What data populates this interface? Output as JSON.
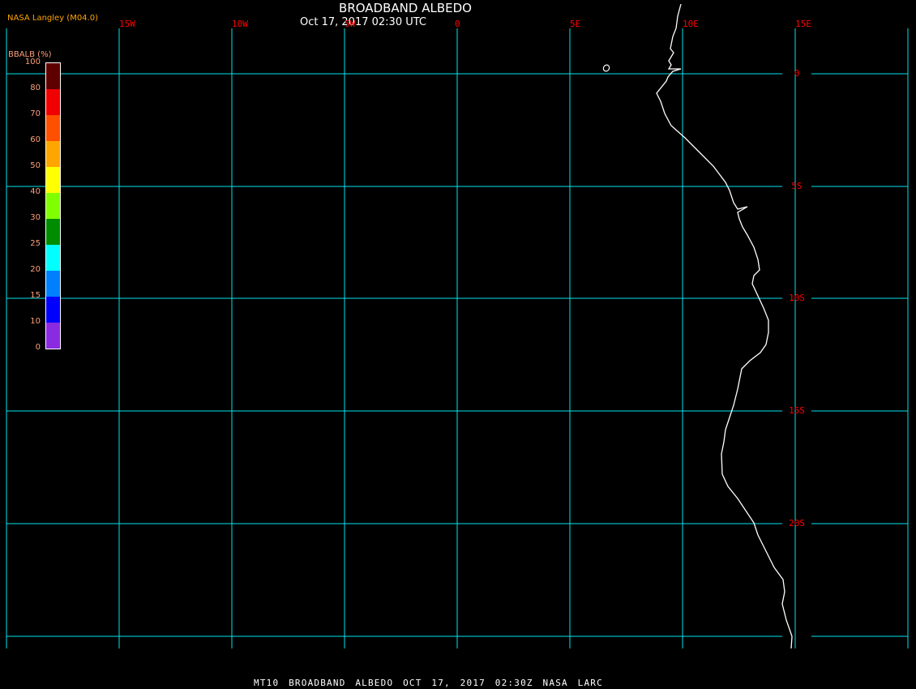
{
  "header": {
    "title": "BROADBAND ALBEDO",
    "subtitle": "Oct 17, 2017 02:30 UTC",
    "organization": "NASA Langley (M04.0)"
  },
  "map": {
    "grid_color": "#00e5ee",
    "coastline_color": "#ffffff",
    "label_color": "#ff0000",
    "longitude_labels": [
      "15W",
      "10W",
      "5W",
      "0",
      "5E",
      "10E",
      "15E"
    ],
    "latitude_labels": [
      "0",
      "5S",
      "10S",
      "15S",
      "20S"
    ]
  },
  "legend": {
    "title": "BBALB (%)",
    "ticks": [
      "100",
      "80",
      "70",
      "60",
      "50",
      "40",
      "30",
      "25",
      "20",
      "15",
      "10",
      "0"
    ],
    "colors": [
      "#5e0000",
      "#f00000",
      "#ff5000",
      "#ffa500",
      "#ffff00",
      "#80ff00",
      "#008c00",
      "#00ffff",
      "#0080ff",
      "#0000ff",
      "#8a2be2"
    ]
  },
  "footer": {
    "text": "MT10  BROADBAND ALBEDO   OCT 17, 2017 02:30Z   NASA LARC"
  }
}
